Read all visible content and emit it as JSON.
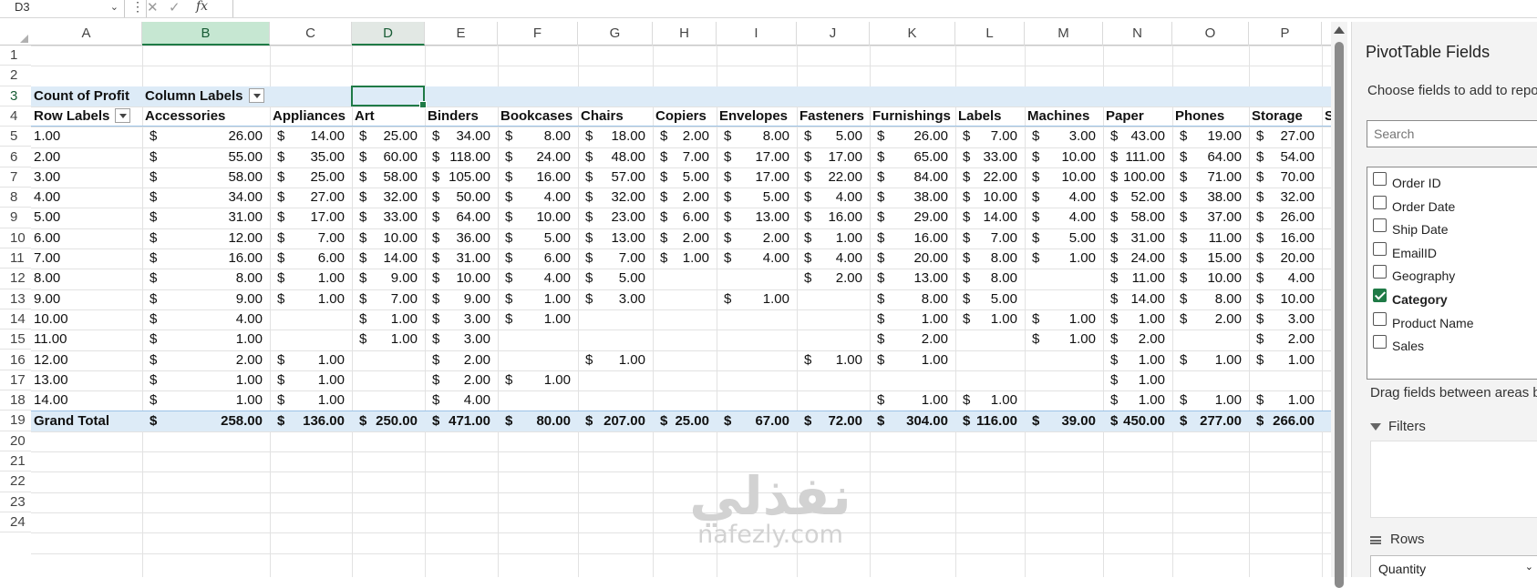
{
  "formula_bar": {
    "name_box": "D3",
    "fx_label": "fx"
  },
  "columns": [
    {
      "letter": "A",
      "w": 122
    },
    {
      "letter": "B",
      "w": 140
    },
    {
      "letter": "C",
      "w": 90
    },
    {
      "letter": "D",
      "w": 80
    },
    {
      "letter": "E",
      "w": 80
    },
    {
      "letter": "F",
      "w": 88
    },
    {
      "letter": "G",
      "w": 82
    },
    {
      "letter": "H",
      "w": 70
    },
    {
      "letter": "I",
      "w": 88
    },
    {
      "letter": "J",
      "w": 80
    },
    {
      "letter": "K",
      "w": 94
    },
    {
      "letter": "L",
      "w": 76
    },
    {
      "letter": "M",
      "w": 86
    },
    {
      "letter": "N",
      "w": 76
    },
    {
      "letter": "O",
      "w": 84
    },
    {
      "letter": "P",
      "w": 80
    }
  ],
  "row_numbers": [
    "1",
    "2",
    "3",
    "4",
    "5",
    "6",
    "7",
    "8",
    "9",
    "10",
    "11",
    "12",
    "13",
    "14",
    "15",
    "16",
    "17",
    "18",
    "19",
    "20",
    "21",
    "22",
    "23",
    "24"
  ],
  "pivot": {
    "corner_label": "Count of Profit",
    "column_labels": "Column Labels",
    "row_labels": "Row Labels",
    "headers": [
      "Accessories",
      "Appliances",
      "Art",
      "Binders",
      "Bookcases",
      "Chairs",
      "Copiers",
      "Envelopes",
      "Fasteners",
      "Furnishings",
      "Labels",
      "Machines",
      "Paper",
      "Phones",
      "Storage",
      "S"
    ],
    "rows": [
      {
        "label": "1.00",
        "values": [
          "26.00",
          "14.00",
          "25.00",
          "34.00",
          "8.00",
          "18.00",
          "2.00",
          "8.00",
          "5.00",
          "26.00",
          "7.00",
          "3.00",
          "43.00",
          "19.00",
          "27.00"
        ]
      },
      {
        "label": "2.00",
        "values": [
          "55.00",
          "35.00",
          "60.00",
          "118.00",
          "24.00",
          "48.00",
          "7.00",
          "17.00",
          "17.00",
          "65.00",
          "33.00",
          "10.00",
          "111.00",
          "64.00",
          "54.00"
        ]
      },
      {
        "label": "3.00",
        "values": [
          "58.00",
          "25.00",
          "58.00",
          "105.00",
          "16.00",
          "57.00",
          "5.00",
          "17.00",
          "22.00",
          "84.00",
          "22.00",
          "10.00",
          "100.00",
          "71.00",
          "70.00"
        ]
      },
      {
        "label": "4.00",
        "values": [
          "34.00",
          "27.00",
          "32.00",
          "50.00",
          "4.00",
          "32.00",
          "2.00",
          "5.00",
          "4.00",
          "38.00",
          "10.00",
          "4.00",
          "52.00",
          "38.00",
          "32.00"
        ]
      },
      {
        "label": "5.00",
        "values": [
          "31.00",
          "17.00",
          "33.00",
          "64.00",
          "10.00",
          "23.00",
          "6.00",
          "13.00",
          "16.00",
          "29.00",
          "14.00",
          "4.00",
          "58.00",
          "37.00",
          "26.00"
        ]
      },
      {
        "label": "6.00",
        "values": [
          "12.00",
          "7.00",
          "10.00",
          "36.00",
          "5.00",
          "13.00",
          "2.00",
          "2.00",
          "1.00",
          "16.00",
          "7.00",
          "5.00",
          "31.00",
          "11.00",
          "16.00"
        ]
      },
      {
        "label": "7.00",
        "values": [
          "16.00",
          "6.00",
          "14.00",
          "31.00",
          "6.00",
          "7.00",
          "1.00",
          "4.00",
          "4.00",
          "20.00",
          "8.00",
          "1.00",
          "24.00",
          "15.00",
          "20.00"
        ]
      },
      {
        "label": "8.00",
        "values": [
          "8.00",
          "1.00",
          "9.00",
          "10.00",
          "4.00",
          "5.00",
          "",
          "",
          "2.00",
          "13.00",
          "8.00",
          "",
          "11.00",
          "10.00",
          "4.00"
        ]
      },
      {
        "label": "9.00",
        "values": [
          "9.00",
          "1.00",
          "7.00",
          "9.00",
          "1.00",
          "3.00",
          "",
          "1.00",
          "",
          "8.00",
          "5.00",
          "",
          "14.00",
          "8.00",
          "10.00"
        ]
      },
      {
        "label": "10.00",
        "values": [
          "4.00",
          "",
          "1.00",
          "3.00",
          "1.00",
          "",
          "",
          "",
          "",
          "1.00",
          "1.00",
          "1.00",
          "1.00",
          "2.00",
          "3.00"
        ]
      },
      {
        "label": "11.00",
        "values": [
          "1.00",
          "",
          "1.00",
          "3.00",
          "",
          "",
          "",
          "",
          "",
          "2.00",
          "",
          "1.00",
          "2.00",
          "",
          "2.00"
        ]
      },
      {
        "label": "12.00",
        "values": [
          "2.00",
          "1.00",
          "",
          "2.00",
          "",
          "1.00",
          "",
          "",
          "1.00",
          "1.00",
          "",
          "",
          "1.00",
          "1.00",
          "1.00"
        ]
      },
      {
        "label": "13.00",
        "values": [
          "1.00",
          "1.00",
          "",
          "2.00",
          "1.00",
          "",
          "",
          "",
          "",
          "",
          "",
          "",
          "1.00",
          "",
          ""
        ]
      },
      {
        "label": "14.00",
        "values": [
          "1.00",
          "1.00",
          "",
          "4.00",
          "",
          "",
          "",
          "",
          "",
          "1.00",
          "1.00",
          "",
          "1.00",
          "1.00",
          "1.00"
        ]
      }
    ],
    "grand_total": {
      "label": "Grand Total",
      "values": [
        "258.00",
        "136.00",
        "250.00",
        "471.00",
        "80.00",
        "207.00",
        "25.00",
        "67.00",
        "72.00",
        "304.00",
        "116.00",
        "39.00",
        "450.00",
        "277.00",
        "266.00"
      ]
    },
    "currency": "$"
  },
  "pane": {
    "title": "PivotTable Fields",
    "subtitle": "Choose fields to add to repo",
    "search_placeholder": "Search",
    "fields": [
      {
        "label": "Order ID",
        "checked": false
      },
      {
        "label": "Order Date",
        "checked": false
      },
      {
        "label": "Ship Date",
        "checked": false
      },
      {
        "label": "EmailID",
        "checked": false
      },
      {
        "label": "Geography",
        "checked": false
      },
      {
        "label": "Category",
        "checked": true
      },
      {
        "label": "Product Name",
        "checked": false
      },
      {
        "label": "Sales",
        "checked": false
      }
    ],
    "drag_hint": "Drag fields between areas b",
    "filters_label": "Filters",
    "rows_label": "Rows",
    "rows_value": "Quantity"
  },
  "watermark": {
    "arabic": "نفذلي",
    "latin": "nafezly.com"
  },
  "colors": {
    "band": "#ddebf7",
    "accent": "#1f7a46",
    "selected_col": "#c6e7d2"
  }
}
